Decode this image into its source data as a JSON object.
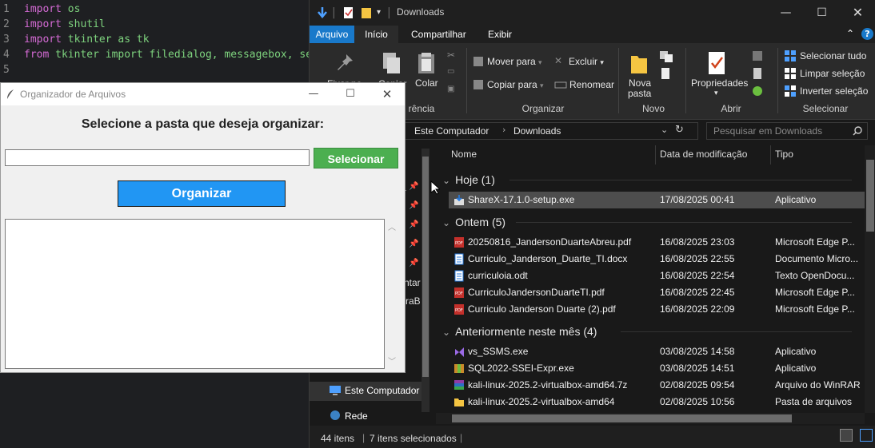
{
  "editor": {
    "lines": [
      {
        "num": "1",
        "kw": "import",
        "rest": " os"
      },
      {
        "num": "2",
        "kw": "import",
        "rest": " shutil"
      },
      {
        "num": "3",
        "kw": "import",
        "rest": " tkinter as tk"
      },
      {
        "num": "4",
        "kw": "from",
        "rest": " tkinter import filedialog, messagebox, se"
      },
      {
        "num": "5",
        "kw": "",
        "rest": ""
      }
    ]
  },
  "explorer": {
    "title": "Downloads",
    "tabs": [
      "Arquivo",
      "Início",
      "Compartilhar",
      "Exibir"
    ],
    "ribbon": {
      "fixar": "Fixar no",
      "copiar": "Copiar",
      "colar": "Colar",
      "mover_para": "Mover para",
      "copiar_para": "Copiar para",
      "excluir": "Excluir",
      "renomear": "Renomear",
      "nova_pasta_1": "Nova",
      "nova_pasta_2": "pasta",
      "propriedades": "Propriedades",
      "selecionar_tudo": "Selecionar tudo",
      "limpar_selecao": "Limpar seleção",
      "inverter_selecao": "Inverter seleção",
      "groups": {
        "area": "rência",
        "organizar": "Organizar",
        "novo": "Novo",
        "abrir": "Abrir",
        "selecionar": "Selecionar"
      }
    },
    "address": {
      "crumb1": "Este Computador",
      "crumb2": "Downloads",
      "search_placeholder": "Pesquisar em Downloads"
    },
    "nav": {
      "este_computador": "Este Computador",
      "rede": "Rede",
      "partial1": "ntar",
      "partial2": "raB",
      "partial3": "a"
    },
    "columns": {
      "name": "Nome",
      "date": "Data de modificação",
      "type": "Tipo"
    },
    "groups": [
      {
        "label": "Hoje (1)",
        "files": [
          {
            "name": "ShareX-17.1.0-setup.exe",
            "date": "17/08/2025 00:41",
            "type": "Aplicativo",
            "icon": "installer-icon",
            "selected": true
          }
        ]
      },
      {
        "label": "Ontem (5)",
        "files": [
          {
            "name": "20250816_JandersonDuarteAbreu.pdf",
            "date": "16/08/2025 23:03",
            "type": "Microsoft Edge P...",
            "icon": "pdf-icon",
            "selected": false
          },
          {
            "name": "Curriculo_Janderson_Duarte_TI.docx",
            "date": "16/08/2025 22:55",
            "type": "Documento Micro...",
            "icon": "doc-icon",
            "selected": false
          },
          {
            "name": "curriculoia.odt",
            "date": "16/08/2025 22:54",
            "type": "Texto OpenDocu...",
            "icon": "doc-icon",
            "selected": false
          },
          {
            "name": "CurriculoJandersonDuarteTI.pdf",
            "date": "16/08/2025 22:45",
            "type": "Microsoft Edge P...",
            "icon": "pdf-icon",
            "selected": false
          },
          {
            "name": "Curriculo Janderson Duarte (2).pdf",
            "date": "16/08/2025 22:09",
            "type": "Microsoft Edge P...",
            "icon": "pdf-icon",
            "selected": false
          }
        ]
      },
      {
        "label": "Anteriormente neste mês (4)",
        "files": [
          {
            "name": "vs_SSMS.exe",
            "date": "03/08/2025 14:58",
            "type": "Aplicativo",
            "icon": "vs-icon",
            "selected": false
          },
          {
            "name": "SQL2022-SSEI-Expr.exe",
            "date": "03/08/2025 14:51",
            "type": "Aplicativo",
            "icon": "package-icon",
            "selected": false
          },
          {
            "name": "kali-linux-2025.2-virtualbox-amd64.7z",
            "date": "02/08/2025 09:54",
            "type": "Arquivo do WinRAR",
            "icon": "archive-icon",
            "selected": false
          },
          {
            "name": "kali-linux-2025.2-virtualbox-amd64",
            "date": "02/08/2025 10:56",
            "type": "Pasta de arquivos",
            "icon": "folder-icon",
            "selected": false
          }
        ]
      }
    ],
    "status": {
      "count": "44 itens",
      "selected": "7 itens selecionados"
    },
    "colors": {
      "accent": "#1979ca",
      "selected_row": "#4d4d4d"
    }
  },
  "tk": {
    "title": "Organizador de Arquivos",
    "prompt": "Selecione a pasta que deseja organizar:",
    "entry_value": "",
    "select_label": "Selecionar",
    "organize_label": "Organizar",
    "colors": {
      "select": "#4caf50",
      "organize": "#2196f3"
    }
  }
}
